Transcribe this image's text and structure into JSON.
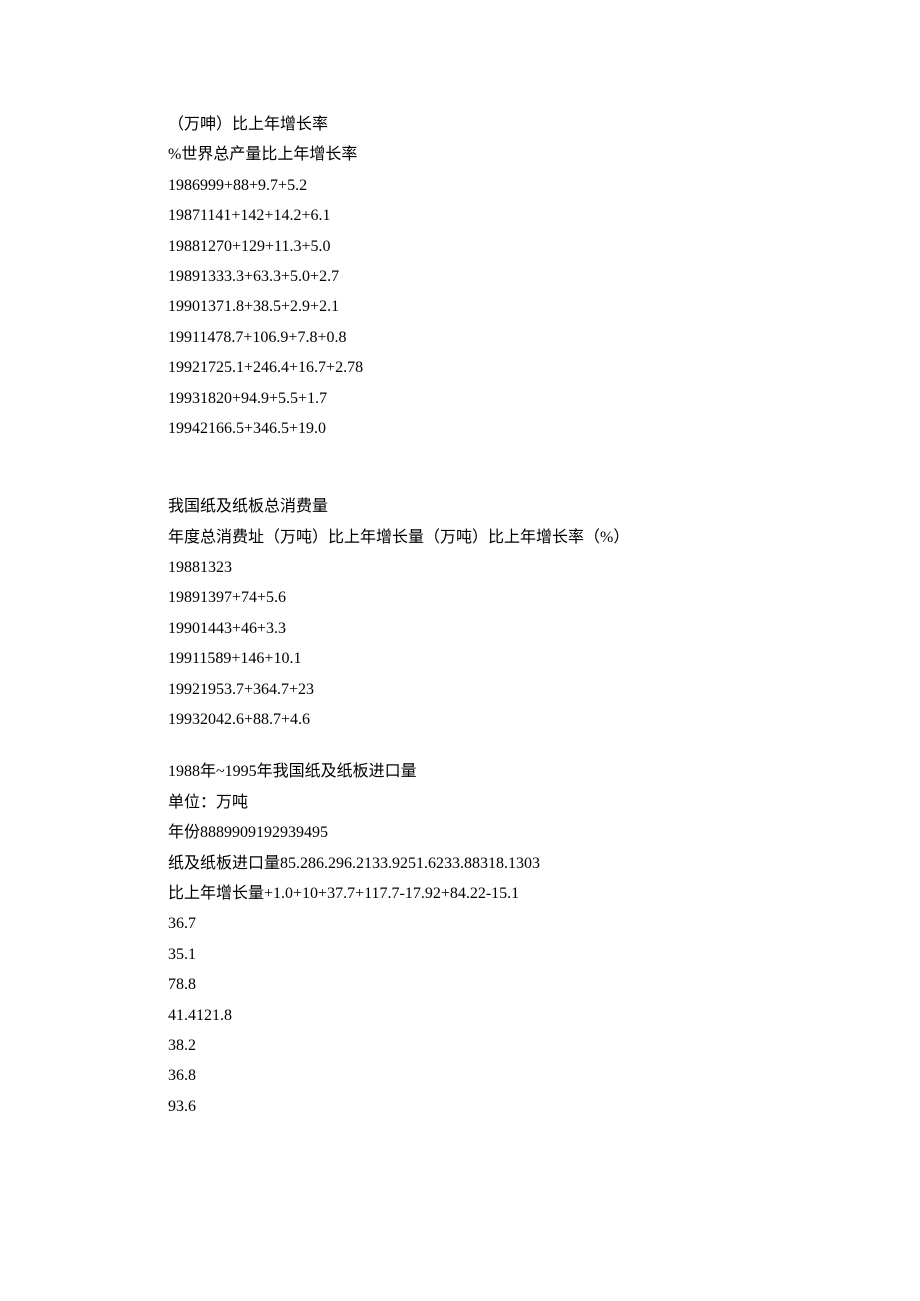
{
  "section1": {
    "header_line1": "（万呻）比上年增长率",
    "header_line2": "%世界总产量比上年增长率",
    "rows": [
      "1986999+88+9.7+5.2",
      "19871141+142+14.2+6.1",
      "19881270+129+11.3+5.0",
      "19891333.3+63.3+5.0+2.7",
      "19901371.8+38.5+2.9+2.1",
      "19911478.7+106.9+7.8+0.8",
      "19921725.1+246.4+16.7+2.78",
      "19931820+94.9+5.5+1.7",
      "19942166.5+346.5+19.0"
    ]
  },
  "section2": {
    "title": "我国纸及纸板总消费量",
    "header": "年度总消费址（万吨）比上年增长量（万吨）比上年增长率（%）",
    "rows": [
      "19881323",
      "19891397+74+5.6",
      "19901443+46+3.3",
      "19911589+146+10.1",
      "19921953.7+364.7+23",
      "19932042.6+88.7+4.6"
    ]
  },
  "section3": {
    "title": "1988年~1995年我国纸及纸板进口量",
    "unit": "单位：万吨",
    "year_row": "年份8889909192939495",
    "import_row": "纸及纸板进口量85.286.296.2133.9251.6233.88318.1303",
    "growth_row": "比上年增长量+1.0+10+37.7+117.7-17.92+84.22-15.1",
    "tail_rows": [
      "36.7",
      "35.1",
      "78.8",
      "41.4121.8",
      "38.2",
      "36.8",
      "93.6"
    ]
  }
}
